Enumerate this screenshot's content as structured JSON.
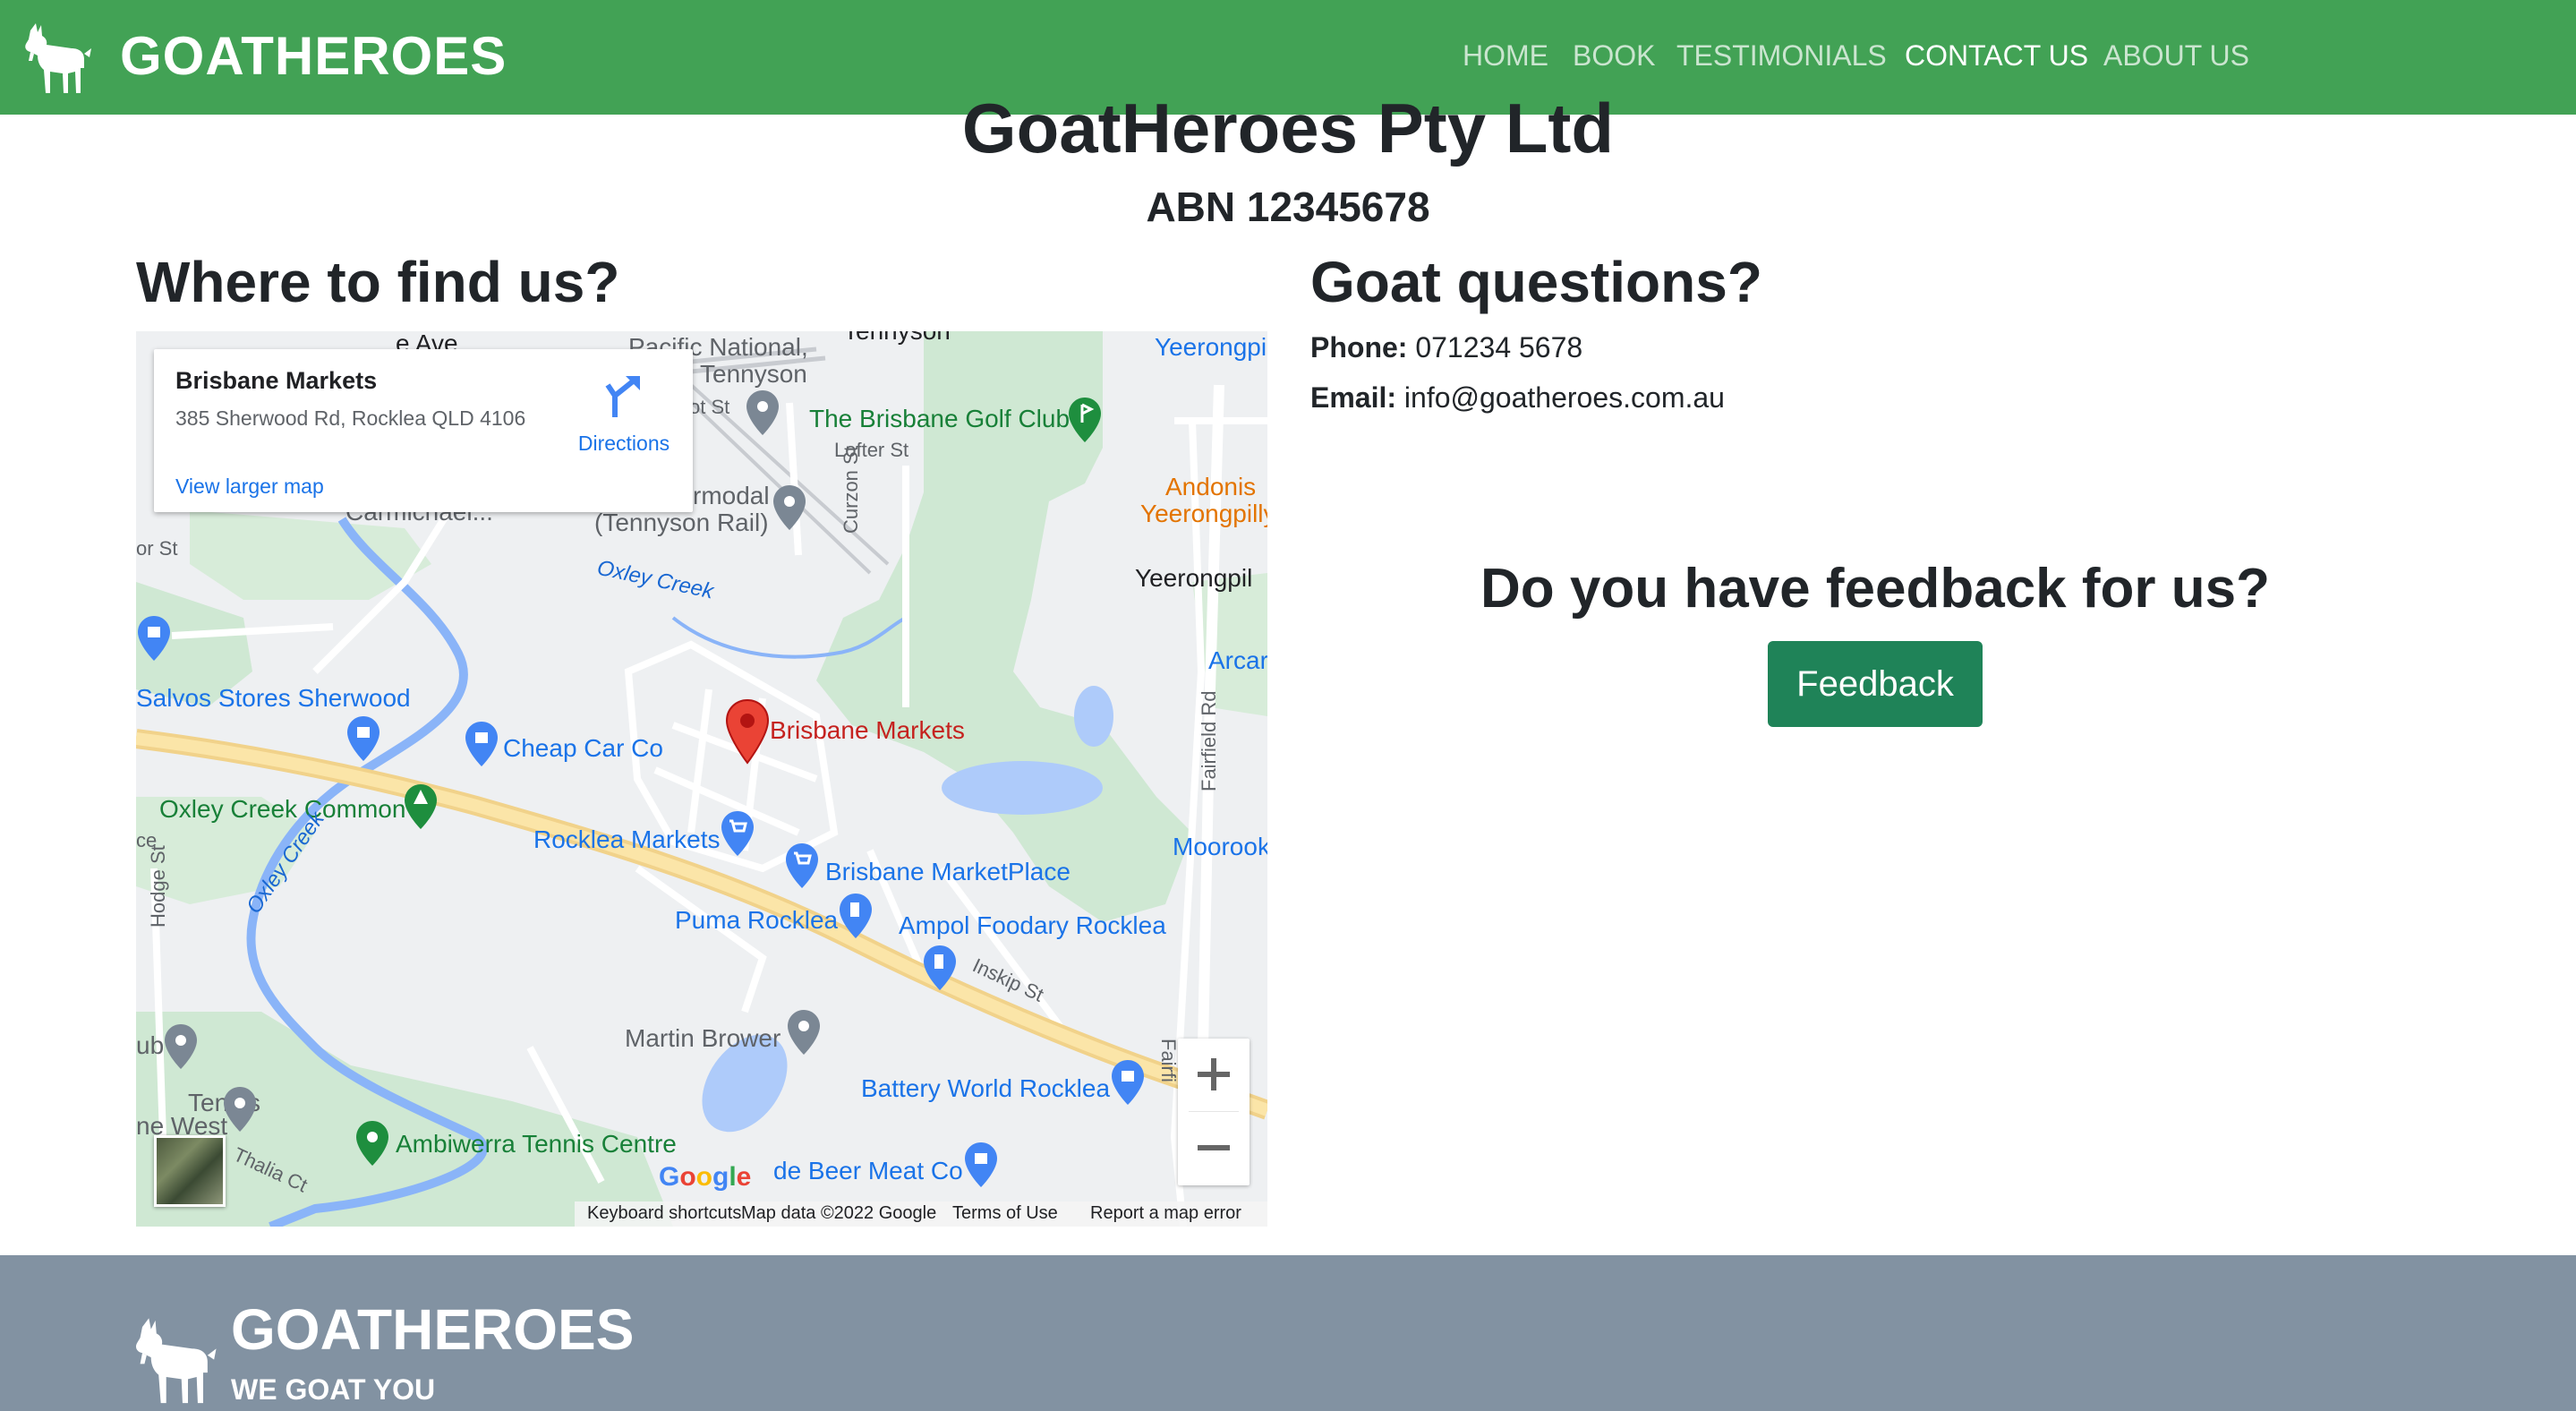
{
  "navbar": {
    "brand": "GOATHEROES",
    "links": [
      {
        "label": "HOME"
      },
      {
        "label": "BOOK"
      },
      {
        "label": "TESTIMONIALS"
      },
      {
        "label": "CONTACT US"
      },
      {
        "label": "ABOUT US"
      }
    ],
    "active": "CONTACT US",
    "color": "#42a255"
  },
  "header": {
    "company": "GoatHeroes Pty Ltd",
    "abn": "ABN 12345678"
  },
  "find_us": {
    "heading": "Where to find us?"
  },
  "contact": {
    "heading": "Goat questions?",
    "phone_label": "Phone:",
    "phone": "071234 5678",
    "email_label": "Email:",
    "email": "info@goatheroes.com.au"
  },
  "feedback": {
    "heading": "Do you have feedback for us?",
    "button": "Feedback",
    "button_color": "#1f8358"
  },
  "map": {
    "info_card": {
      "title": "Brisbane Markets",
      "address": "385 Sherwood Rd, Rocklea QLD 4106",
      "directions": "Directions",
      "larger_map": "View larger map"
    },
    "labels": {
      "pacific": "Pacific National,",
      "tennyson": "Tennyson",
      "tennyson_top": "Tennyson",
      "yeerongpilly_top": "Yeerongpill",
      "golf": "The Brisbane Golf Club",
      "lofter": "Lofter St",
      "andonis1": "Andonis",
      "andonis2": "Yeerongpilly",
      "intermodal": "rmodal",
      "tennyson_rail": "(Tennyson Rail)",
      "carmichael": "Carmichael...",
      "ave": "e Ave",
      "ot_st": "ot St",
      "or_st": "or St",
      "oxley_creek_1": "Oxley Creek",
      "curzon": "Curzon St",
      "yeerongpil": "Yeerongpil",
      "arcan": "Arcar",
      "salvos": "Salvos Stores Sherwood",
      "cheap_car": "Cheap Car Co",
      "brisbane_markets": "Brisbane Markets",
      "fairfield": "Fairfield Rd",
      "oxley_common": "Oxley Creek Common",
      "rocklea_markets": "Rocklea Markets",
      "marketplace": "Brisbane MarketPlace",
      "moorook": "Moorook",
      "hodge": "Hodge St",
      "oxley_creek_2": "Oxley Creek",
      "puma": "Puma Rocklea",
      "ampol": "Ampol Foodary Rocklea",
      "inskip": "Inskip St",
      "fairfi": "Fairfi",
      "ub": "ub",
      "martin": "Martin Brower",
      "battery": "Battery World Rocklea",
      "tennis_west1": "Tennis",
      "tennis_west2": "ne West",
      "ambiwerra": "Ambiwerra Tennis Centre",
      "thalia": "Thalia Ct",
      "debeer": "de Beer Meat Co",
      "ce": "ce"
    },
    "google": "Google",
    "footer": [
      "Keyboard shortcuts",
      "Map data ©2022 Google",
      "Terms of Use",
      "Report a map error"
    ]
  },
  "footer": {
    "brand": "GOATHEROES",
    "tagline": "WE GOAT YOU",
    "color": "#8292a2"
  }
}
